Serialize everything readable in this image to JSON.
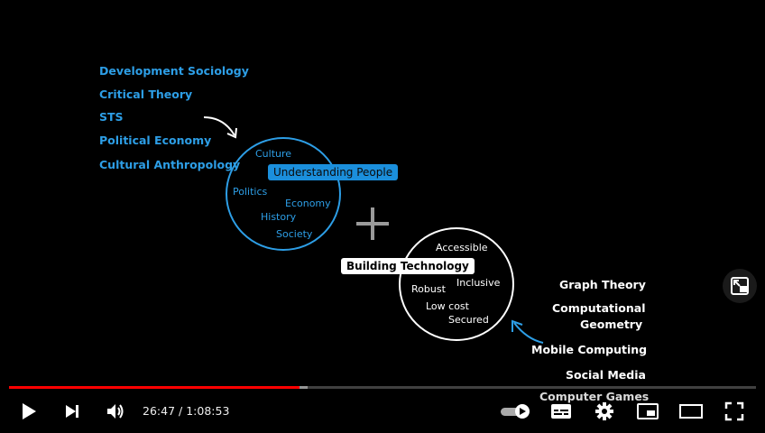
{
  "slide": {
    "left_disciplines": [
      "Development Sociology",
      "Critical Theory",
      "STS",
      "Political Economy",
      "Cultural Anthropology"
    ],
    "people_circle": {
      "label": "Understanding People",
      "words": [
        "Culture",
        "Politics",
        "Economy",
        "History",
        "Society"
      ]
    },
    "tech_circle": {
      "label": "Building Technology",
      "words": [
        "Accessible",
        "Inclusive",
        "Robust",
        "Low cost",
        "Secured"
      ]
    },
    "right_disciplines": [
      "Graph Theory",
      "Computational",
      "Geometry",
      "Mobile Computing",
      "Social Media",
      "Computer Games"
    ],
    "colors": {
      "accent_blue": "#2d9ee6",
      "text_white": "#ffffff",
      "background": "#000000"
    }
  },
  "player": {
    "current_time": "26:47",
    "separator": " / ",
    "duration": "1:08:53",
    "progress_fraction": 0.3886,
    "buffered_fraction": 0.4,
    "colors": {
      "played": "#ff0000"
    },
    "icons": [
      "play-icon",
      "next-icon",
      "volume-icon",
      "autoplay-toggle-icon",
      "subtitles-icon",
      "settings-icon",
      "miniplayer-icon",
      "theater-mode-icon",
      "fullscreen-icon",
      "exit-pip-icon"
    ]
  }
}
